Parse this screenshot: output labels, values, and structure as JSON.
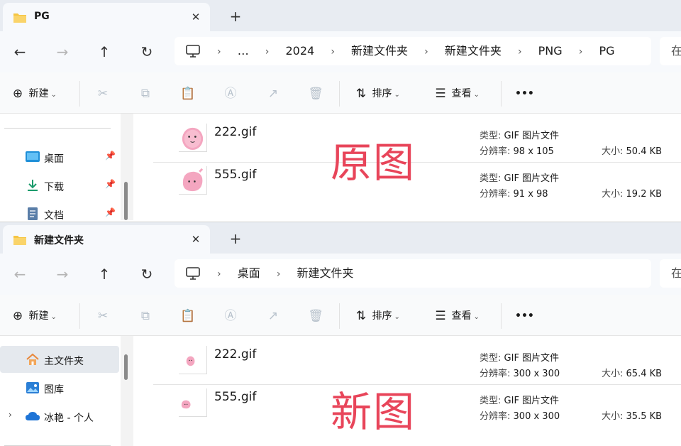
{
  "window_top": {
    "tab_title": "PG",
    "path": [
      "…",
      "2024",
      "新建文件夹",
      "新建文件夹",
      "PNG",
      "PG"
    ],
    "search_hint": "在",
    "annotation": "原图",
    "sidebar": [
      {
        "label": "桌面",
        "icon": "desktop-icon",
        "pinned": true
      },
      {
        "label": "下载",
        "icon": "download-icon",
        "pinned": true
      },
      {
        "label": "文档",
        "icon": "document-icon",
        "pinned": true
      }
    ],
    "files": [
      {
        "name": "222.gif",
        "type_label": "类型:",
        "type": "GIF 图片文件",
        "dim_label": "分辨率:",
        "dim": "98 x 105",
        "size_label": "大小:",
        "size": "50.4 KB"
      },
      {
        "name": "555.gif",
        "type_label": "类型:",
        "type": "GIF 图片文件",
        "dim_label": "分辨率:",
        "dim": "91 x 98",
        "size_label": "大小:",
        "size": "19.2 KB"
      }
    ]
  },
  "window_bottom": {
    "tab_title": "新建文件夹",
    "path": [
      "桌面",
      "新建文件夹"
    ],
    "search_hint": "在",
    "annotation": "新图",
    "sidebar": [
      {
        "label": "主文件夹",
        "icon": "home-icon",
        "selected": true
      },
      {
        "label": "图库",
        "icon": "gallery-icon"
      },
      {
        "label": "冰艳 - 个人",
        "icon": "onedrive-cloud-icon",
        "expandable": true
      }
    ],
    "files": [
      {
        "name": "222.gif",
        "type_label": "类型:",
        "type": "GIF 图片文件",
        "dim_label": "分辨率:",
        "dim": "300 x 300",
        "size_label": "大小:",
        "size": "65.4 KB"
      },
      {
        "name": "555.gif",
        "type_label": "类型:",
        "type": "GIF 图片文件",
        "dim_label": "分辨率:",
        "dim": "300 x 300",
        "size_label": "大小:",
        "size": "35.5 KB"
      }
    ]
  },
  "toolbar": {
    "new_label": "新建",
    "sort_label": "排序",
    "view_label": "查看",
    "more_label": "•••"
  },
  "colors": {
    "annotation": "#e8455a",
    "folder": "#f5c542",
    "thumb_pink": "#f4a6c0"
  }
}
